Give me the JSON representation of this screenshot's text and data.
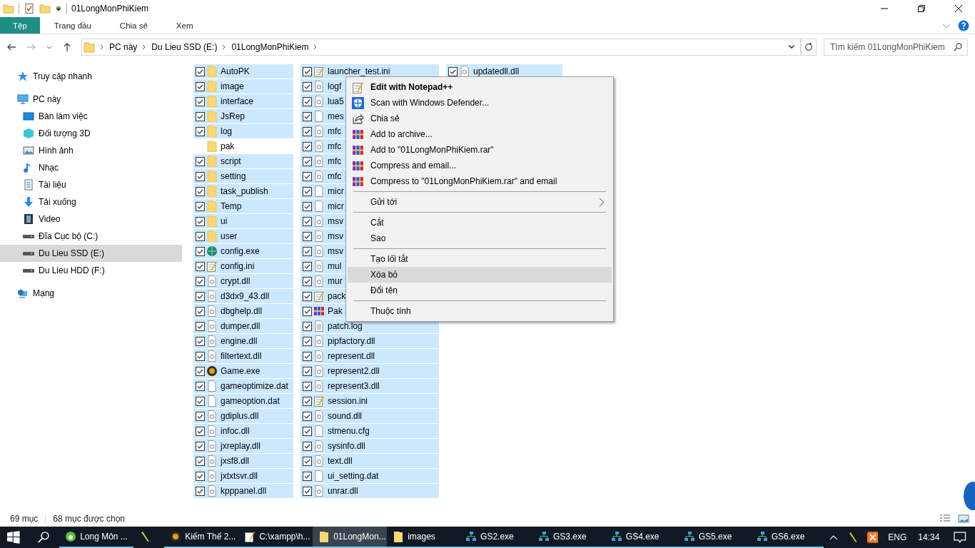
{
  "window": {
    "title": "01LongMonPhiKiem"
  },
  "ribbon_tabs": [
    {
      "label": "Tệp",
      "selected": true
    },
    {
      "label": "Trang đầu",
      "selected": false
    },
    {
      "label": "Chia sẻ",
      "selected": false
    },
    {
      "label": "Xem",
      "selected": false
    }
  ],
  "breadcrumb": [
    "PC này",
    "Du Lieu SSD (E:)",
    "01LongMonPhiKiem"
  ],
  "search": {
    "placeholder": "Tìm kiếm 01LongMonPhiKiem"
  },
  "sidebar": {
    "items": [
      {
        "label": "Truy cập nhanh",
        "selected": false
      },
      {
        "label": "PC này",
        "selected": false,
        "children": [
          {
            "label": "Bàn làm việc",
            "selected": false
          },
          {
            "label": "Đối tượng 3D",
            "selected": false
          },
          {
            "label": "Hình ảnh",
            "selected": false
          },
          {
            "label": "Nhạc",
            "selected": false
          },
          {
            "label": "Tài liệu",
            "selected": false
          },
          {
            "label": "Tải xuống",
            "selected": false
          },
          {
            "label": "Video",
            "selected": false
          },
          {
            "label": "Đĩa Cục bộ (C:)",
            "selected": false
          },
          {
            "label": "Du Lieu SSD (E:)",
            "selected": true
          },
          {
            "label": "Du Lieu HDD (F:)",
            "selected": false
          }
        ]
      },
      {
        "label": "Mạng",
        "selected": false
      }
    ]
  },
  "files": {
    "columns": [
      [
        {
          "name": "AutoPK",
          "kind": "folder",
          "selected": true
        },
        {
          "name": "image",
          "kind": "folder",
          "selected": true
        },
        {
          "name": "interface",
          "kind": "folder",
          "selected": true
        },
        {
          "name": "JsRep",
          "kind": "folder",
          "selected": true
        },
        {
          "name": "log",
          "kind": "folder",
          "selected": true
        },
        {
          "name": "pak",
          "kind": "folder",
          "selected": false
        },
        {
          "name": "script",
          "kind": "folder",
          "selected": true
        },
        {
          "name": "setting",
          "kind": "folder",
          "selected": true
        },
        {
          "name": "task_publish",
          "kind": "folder",
          "selected": true
        },
        {
          "name": "Temp",
          "kind": "folder",
          "selected": true
        },
        {
          "name": "ui",
          "kind": "folder",
          "selected": true
        },
        {
          "name": "user",
          "kind": "folder",
          "selected": true
        },
        {
          "name": "config.exe",
          "kind": "exe",
          "selected": true
        },
        {
          "name": "config.ini",
          "kind": "ini",
          "selected": true
        },
        {
          "name": "crypt.dll",
          "kind": "dll",
          "selected": true
        },
        {
          "name": "d3dx9_43.dll",
          "kind": "dll",
          "selected": true
        },
        {
          "name": "dbghelp.dll",
          "kind": "dll",
          "selected": true
        },
        {
          "name": "dumper.dll",
          "kind": "dll",
          "selected": true
        },
        {
          "name": "engine.dll",
          "kind": "dll",
          "selected": true
        },
        {
          "name": "filtertext.dll",
          "kind": "dll",
          "selected": true
        },
        {
          "name": "Game.exe",
          "kind": "game",
          "selected": true
        },
        {
          "name": "gameoptimize.dat",
          "kind": "file",
          "selected": true
        },
        {
          "name": "gameoption.dat",
          "kind": "file",
          "selected": true
        },
        {
          "name": "gdiplus.dll",
          "kind": "dll",
          "selected": true
        },
        {
          "name": "infoc.dll",
          "kind": "dll",
          "selected": true
        },
        {
          "name": "jxreplay.dll",
          "kind": "dll",
          "selected": true
        },
        {
          "name": "jxsf8.dll",
          "kind": "dll",
          "selected": true
        },
        {
          "name": "jxtxtsvr.dll",
          "kind": "dll",
          "selected": true
        },
        {
          "name": "kpppanel.dll",
          "kind": "dll",
          "selected": true
        }
      ],
      [
        {
          "name": "launcher_test.ini",
          "kind": "ini",
          "selected": true
        },
        {
          "name": "logf",
          "kind": "dll",
          "selected": true
        },
        {
          "name": "lua5",
          "kind": "dll",
          "selected": true
        },
        {
          "name": "mes",
          "kind": "file",
          "selected": true
        },
        {
          "name": "mfc",
          "kind": "dll",
          "selected": true
        },
        {
          "name": "mfc",
          "kind": "dll",
          "selected": true
        },
        {
          "name": "mfc",
          "kind": "dll",
          "selected": true
        },
        {
          "name": "mfc",
          "kind": "dll",
          "selected": true
        },
        {
          "name": "micr",
          "kind": "file",
          "selected": true
        },
        {
          "name": "micr",
          "kind": "file",
          "selected": true
        },
        {
          "name": "msv",
          "kind": "dll",
          "selected": true
        },
        {
          "name": "msv",
          "kind": "dll",
          "selected": true
        },
        {
          "name": "msv",
          "kind": "dll",
          "selected": true
        },
        {
          "name": "mul",
          "kind": "dll",
          "selected": true
        },
        {
          "name": "mur",
          "kind": "dll",
          "selected": true
        },
        {
          "name": "pack",
          "kind": "ini",
          "selected": true
        },
        {
          "name": "Pak",
          "kind": "rar",
          "selected": true
        },
        {
          "name": "patch.log",
          "kind": "log",
          "selected": true
        },
        {
          "name": "pipfactory.dll",
          "kind": "dll",
          "selected": true
        },
        {
          "name": "represent.dll",
          "kind": "dll",
          "selected": true
        },
        {
          "name": "represent2.dll",
          "kind": "dll",
          "selected": true
        },
        {
          "name": "represent3.dll",
          "kind": "dll",
          "selected": true
        },
        {
          "name": "session.ini",
          "kind": "ini",
          "selected": true
        },
        {
          "name": "sound.dll",
          "kind": "dll",
          "selected": true
        },
        {
          "name": "stmenu.cfg",
          "kind": "file",
          "selected": true
        },
        {
          "name": "sysinfo.dll",
          "kind": "dll",
          "selected": true
        },
        {
          "name": "text.dll",
          "kind": "dll",
          "selected": true
        },
        {
          "name": "ui_setting.dat",
          "kind": "file",
          "selected": true
        },
        {
          "name": "unrar.dll",
          "kind": "dll",
          "selected": true
        }
      ],
      [
        {
          "name": "updatedll.dll",
          "kind": "dll",
          "selected": true
        }
      ]
    ]
  },
  "context_menu": {
    "groups": [
      [
        {
          "label": "Edit with Notepad++",
          "bold": true,
          "selected": false
        },
        {
          "label": "Scan with Windows Defender...",
          "bold": false,
          "selected": false
        },
        {
          "label": "Chia sẻ",
          "bold": false,
          "selected": false
        },
        {
          "label": "Add to archive...",
          "bold": false,
          "selected": false
        },
        {
          "label": "Add to \"01LongMonPhiKiem.rar\"",
          "bold": false,
          "selected": false
        },
        {
          "label": "Compress and email...",
          "bold": false,
          "selected": false
        },
        {
          "label": "Compress to \"01LongMonPhiKiem.rar\" and email",
          "bold": false,
          "selected": false
        }
      ],
      [
        {
          "label": "Gửi tới",
          "submenu": true,
          "bold": false,
          "selected": false
        }
      ],
      [
        {
          "label": "Cắt",
          "bold": false,
          "selected": false
        },
        {
          "label": "Sao",
          "bold": false,
          "selected": false
        }
      ],
      [
        {
          "label": "Tạo lối tắt",
          "bold": false,
          "selected": false
        },
        {
          "label": "Xóa bỏ",
          "bold": false,
          "selected": true
        },
        {
          "label": "Đổi tên",
          "bold": false,
          "selected": false
        }
      ],
      [
        {
          "label": "Thuộc tính",
          "bold": false,
          "selected": false
        }
      ]
    ]
  },
  "status_bar": {
    "count": "69 mục",
    "selected": "68 mục được chọn"
  },
  "taskbar": {
    "apps": [
      {
        "label": "Long Môn ...",
        "running": true,
        "selected": false
      },
      {
        "running": false,
        "selected": false
      },
      {
        "label": "Kiếm Thế 2...",
        "running": true,
        "selected": false
      },
      {
        "label": "C:\\xampp\\h...",
        "running": true,
        "selected": false
      },
      {
        "label": "01LongMon...",
        "running": true,
        "selected": true
      },
      {
        "label": "images",
        "running": true,
        "selected": false
      },
      {
        "label": "GS2.exe",
        "running": true,
        "selected": false
      },
      {
        "label": "GS3.exe",
        "running": true,
        "selected": false
      },
      {
        "label": "GS4.exe",
        "running": true,
        "selected": false
      },
      {
        "label": "GS5.exe",
        "running": true,
        "selected": false
      },
      {
        "label": "GS6.exe",
        "running": true,
        "selected": false
      }
    ],
    "language": "ENG",
    "time": "14:34"
  }
}
